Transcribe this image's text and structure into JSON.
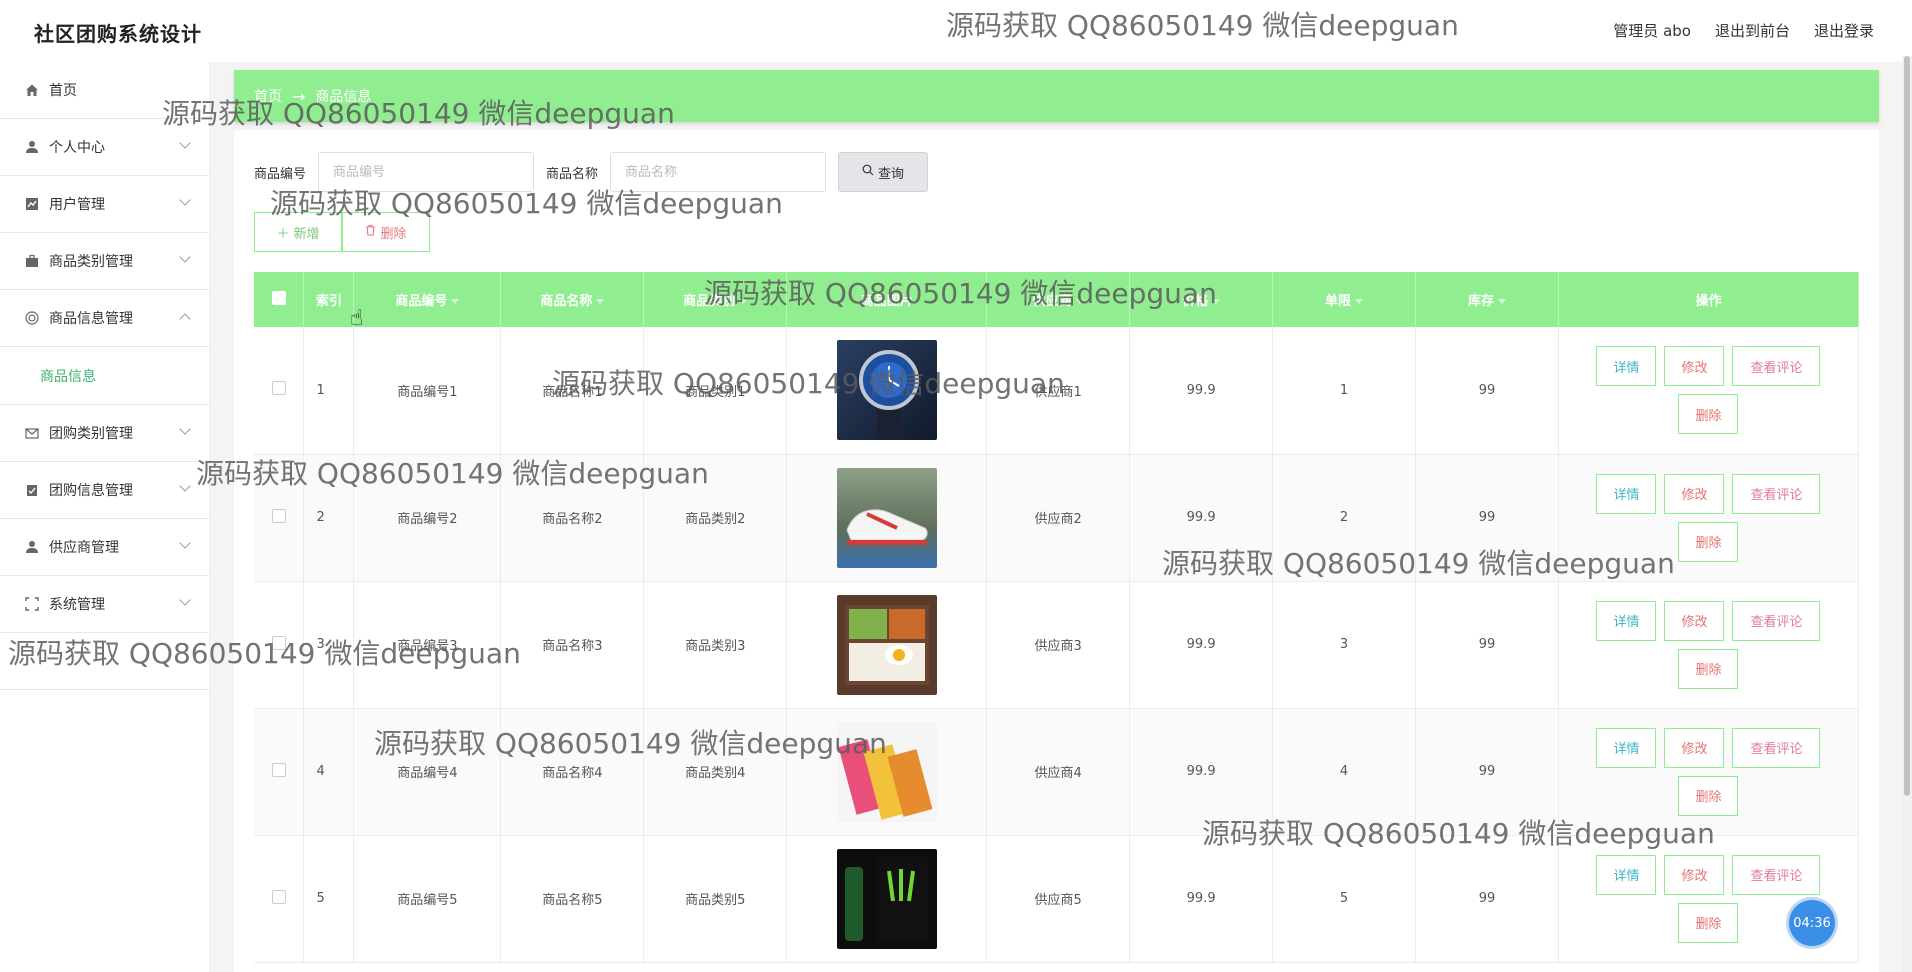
{
  "header": {
    "title": "社区团购系统设计",
    "user_label": "管理员 abo",
    "to_front": "退出到前台",
    "logout": "退出登录"
  },
  "sidebar": {
    "items": [
      {
        "label": "首页",
        "icon": "home-icon",
        "expandable": false
      },
      {
        "label": "个人中心",
        "icon": "user-icon",
        "expandable": true
      },
      {
        "label": "用户管理",
        "icon": "chart-icon",
        "expandable": true
      },
      {
        "label": "商品类别管理",
        "icon": "briefcase-icon",
        "expandable": true
      },
      {
        "label": "商品信息管理",
        "icon": "target-icon",
        "expandable": true,
        "expanded": true
      },
      {
        "label": "团购类别管理",
        "icon": "mail-icon",
        "expandable": true
      },
      {
        "label": "团购信息管理",
        "icon": "clipboard-icon",
        "expandable": true
      },
      {
        "label": "供应商管理",
        "icon": "user-icon",
        "expandable": true
      },
      {
        "label": "系统管理",
        "icon": "frame-icon",
        "expandable": true
      }
    ],
    "sub_item": "商品信息"
  },
  "breadcrumb": {
    "home": "首页",
    "sep": "→",
    "current": "商品信息"
  },
  "search": {
    "label1": "商品编号",
    "placeholder1": "商品编号",
    "label2": "商品名称",
    "placeholder2": "商品名称",
    "query": "查询"
  },
  "actions": {
    "add": "新增",
    "delete": "删除"
  },
  "table": {
    "headers": [
      "索引",
      "商品编号",
      "商品名称",
      "商品类别",
      "商品图片",
      "供应商",
      "价格",
      "单限",
      "库存",
      "操作"
    ],
    "rows": [
      {
        "idx": "1",
        "code": "商品编号1",
        "name": "商品名称1",
        "cat": "商品类别1",
        "supplier": "供应商1",
        "price": "99.9",
        "limit": "1",
        "stock": "99"
      },
      {
        "idx": "2",
        "code": "商品编号2",
        "name": "商品名称2",
        "cat": "商品类别2",
        "supplier": "供应商2",
        "price": "99.9",
        "limit": "2",
        "stock": "99"
      },
      {
        "idx": "3",
        "code": "商品编号3",
        "name": "商品名称3",
        "cat": "商品类别3",
        "supplier": "供应商3",
        "price": "99.9",
        "limit": "3",
        "stock": "99"
      },
      {
        "idx": "4",
        "code": "商品编号4",
        "name": "商品名称4",
        "cat": "商品类别4",
        "supplier": "供应商4",
        "price": "99.9",
        "limit": "4",
        "stock": "99"
      },
      {
        "idx": "5",
        "code": "商品编号5",
        "name": "商品名称5",
        "cat": "商品类别5",
        "supplier": "供应商5",
        "price": "99.9",
        "limit": "5",
        "stock": "99"
      }
    ],
    "ops": {
      "detail": "详情",
      "edit": "修改",
      "review": "查看评论",
      "delete": "删除"
    }
  },
  "watermark": "源码获取 QQ86050149 微信deepguan",
  "timer": "04:36"
}
